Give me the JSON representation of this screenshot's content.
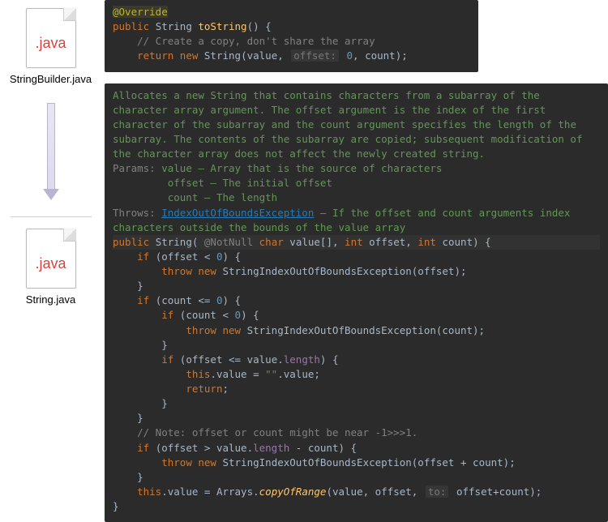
{
  "files": {
    "top": {
      "ext": ".java",
      "name": "StringBuilder.java"
    },
    "bottom": {
      "ext": ".java",
      "name": "String.java"
    }
  },
  "editor_top": {
    "ann_override": "@Override",
    "kw_public": "public",
    "type_string": "String",
    "fn_tostring": "toString",
    "sig_suffix": "() {",
    "comment1": "// Create a copy, don't share the array",
    "kw_return": "return",
    "kw_new": "new",
    "ctor_string": "String",
    "arg_value": "value,",
    "hint_offset": "offset:",
    "arg_zero": "0",
    "arg_count": ", count);"
  },
  "editor_bottom": {
    "doc_p1": "Allocates a new String that contains characters from a subarray of the character array argument. The ",
    "doc_p1_offset": "offset",
    "doc_p1b": " argument is the index of the first character of the subarray and the ",
    "doc_p1_count": "count",
    "doc_p1c": " argument specifies the length of the subarray. The contents of the subarray are copied; subsequent modification of the character array does not affect the newly created string.",
    "doc_params_k": "Params:",
    "doc_param_value": "value – Array that is the source of characters",
    "doc_param_offset": "offset – The initial offset",
    "doc_param_count": "count – The length",
    "doc_throws_k": "Throws:",
    "doc_throws_exc": "IndexOutOfBoundsException",
    "doc_throws_txt": " – If the offset and count arguments index characters outside the bounds of the value array",
    "sig_public": "public",
    "sig_ctor": "String",
    "sig_notnull": "@NotNull",
    "sig_char": "char",
    "sig_valuearr": "value[],",
    "sig_int1": "int",
    "sig_offset": "offset,",
    "sig_int2": "int",
    "sig_count": "count) {",
    "l1_if": "if",
    "l1_cond": " (offset < ",
    "l1_zero": "0",
    "l1_end": ") {",
    "l2_throw": "throw new",
    "l2_exc": "StringIndexOutOfBoundsException",
    "l2_arg": "(offset);",
    "brace": "}",
    "l3_if": "if",
    "l3_cond": " (count <= ",
    "l3_zero": "0",
    "l3_end": ") {",
    "l4_if": "if",
    "l4_cond": " (count < ",
    "l4_zero": "0",
    "l4_end": ") {",
    "l5_throw": "throw new",
    "l5_exc": "StringIndexOutOfBoundsException",
    "l5_arg": "(count);",
    "l6_if": "if",
    "l6_cond": " (offset <= value.",
    "l6_prop": "length",
    "l6_end": ") {",
    "l7_this": "this",
    "l7_value": ".value = ",
    "l7_str": "\"\"",
    "l7_dotvalue": ".value;",
    "l8_return": "return",
    "l8_semi": ";",
    "cmt_note": "// Note: offset or count might be near -1>>>1.",
    "l9_if": "if",
    "l9_cond": " (offset > value.",
    "l9_prop": "length",
    "l9_minus": " - count) {",
    "l10_throw": "throw new",
    "l10_exc": "StringIndexOutOfBoundsException",
    "l10_arg": "(offset + count);",
    "l11_this": "this",
    "l11_value": ".value = Arrays.",
    "l11_fn": "copyOfRange",
    "l11_args": "(value, offset, ",
    "l11_hint": "to:",
    "l11_end": " offset+count);"
  }
}
